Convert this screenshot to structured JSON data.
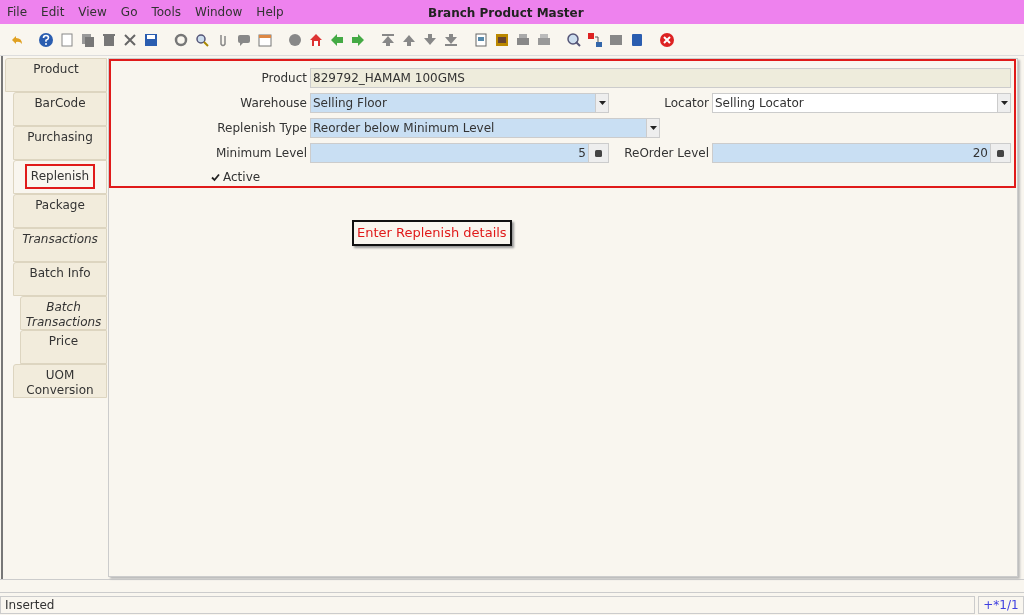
{
  "menu": [
    "File",
    "Edit",
    "View",
    "Go",
    "Tools",
    "Window",
    "Help"
  ],
  "window": {
    "title": "Branch Product Master"
  },
  "tabs": [
    {
      "label": "Product",
      "selected": false,
      "kind": "normal"
    },
    {
      "label": "BarCode",
      "selected": false,
      "kind": "normal"
    },
    {
      "label": "Purchasing",
      "selected": false,
      "kind": "normal"
    },
    {
      "label": "Replenish",
      "selected": true,
      "kind": "normal",
      "highlighted": true
    },
    {
      "label": "Package",
      "selected": false,
      "kind": "normal"
    },
    {
      "label": "Transactions",
      "selected": false,
      "kind": "italic"
    },
    {
      "label": "Batch Info",
      "selected": false,
      "kind": "normal",
      "children": [
        {
          "label": "Batch Transactions",
          "selected": false,
          "kind": "italic"
        },
        {
          "label": "Price",
          "selected": false,
          "kind": "normal"
        }
      ]
    },
    {
      "label": "UOM Conversion",
      "selected": false,
      "kind": "normal"
    }
  ],
  "form": {
    "product": {
      "label": "Product",
      "value": "829792_HAMAM 100GMS"
    },
    "warehouse": {
      "label": "Warehouse",
      "value": "Selling Floor"
    },
    "locator": {
      "label": "Locator",
      "value": "Selling Locator"
    },
    "replenish_type": {
      "label": "Replenish Type",
      "value": "Reorder below Minimum Level"
    },
    "minimum_level": {
      "label": "Minimum Level",
      "value": "5"
    },
    "reorder_level": {
      "label": "ReOrder Level",
      "value": "20"
    },
    "active": {
      "label": "Active",
      "checked": true
    }
  },
  "callout": "Enter Replenish details",
  "status_bar": {
    "message": "Inserted",
    "record": "+*1/1"
  }
}
